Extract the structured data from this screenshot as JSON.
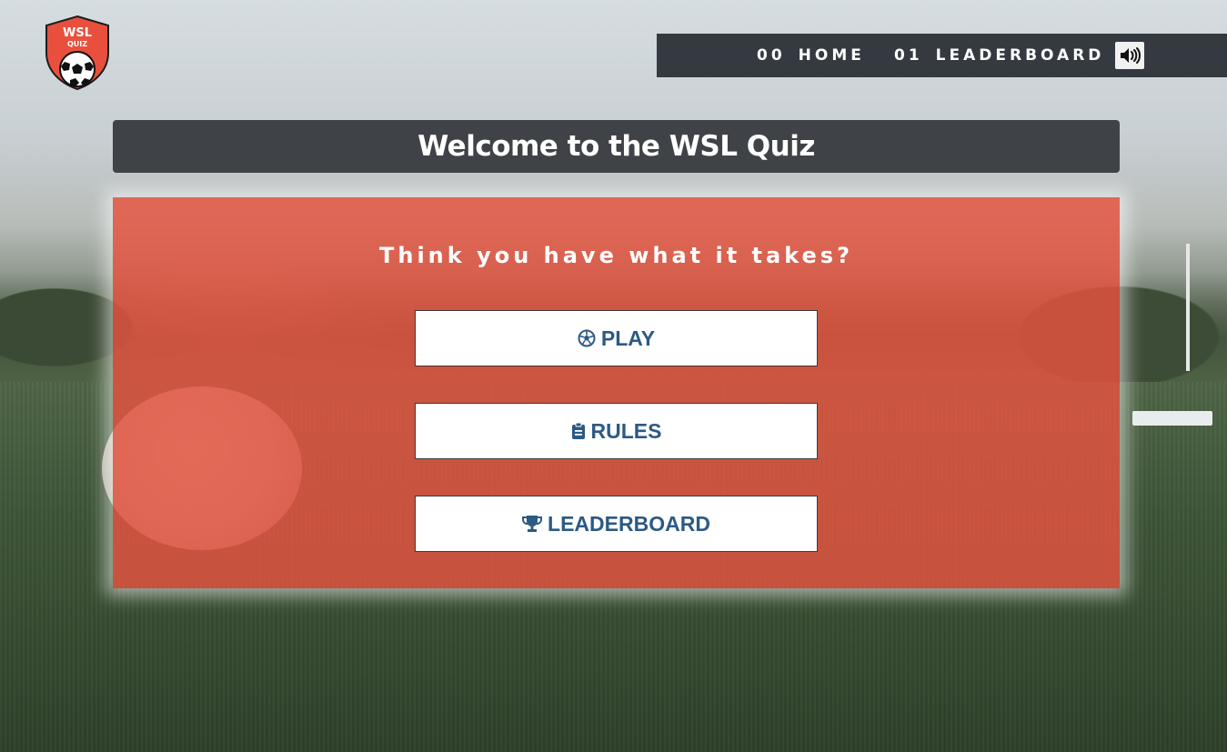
{
  "logo": {
    "line1": "WSL",
    "line2": "QUIZ",
    "icon": "soccer-ball-shield-icon"
  },
  "nav": {
    "items": [
      {
        "num": "00",
        "label": "HOME"
      },
      {
        "num": "01",
        "label": "LEADERBOARD"
      }
    ],
    "sound_icon": "volume-icon"
  },
  "title": "Welcome to the WSL Quiz",
  "tagline": "Think you have what it takes?",
  "buttons": [
    {
      "label": "PLAY",
      "icon": "futbol-icon"
    },
    {
      "label": "RULES",
      "icon": "clipboard-icon"
    },
    {
      "label": "LEADERBOARD",
      "icon": "trophy-icon"
    }
  ],
  "colors": {
    "panel": "#e7533f",
    "nav_bg": "#343a40",
    "title_bg": "#3f4246",
    "button_text": "#2c5a84"
  }
}
